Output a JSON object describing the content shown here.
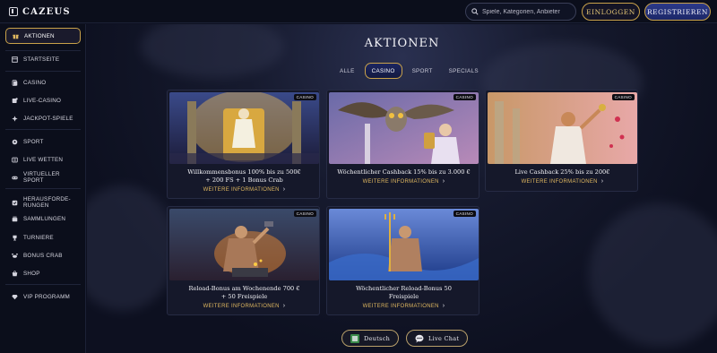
{
  "header": {
    "logo_text": "CAZEUS",
    "search_placeholder": "Spiele, Kategorien, Anbieter",
    "login_label": "EINLOGGEN",
    "register_label": "REGISTRIEREN"
  },
  "sidebar": {
    "items": [
      {
        "label": "AKTIONEN",
        "icon": "gift-icon",
        "active": true
      },
      {
        "label": "STARTSEITE",
        "icon": "home-icon"
      },
      {
        "label": "CASINO",
        "icon": "cards-icon"
      },
      {
        "label": "LIVE-CASINO",
        "icon": "live-casino-icon"
      },
      {
        "label": "JACKPOT-SPIELE",
        "icon": "jackpot-icon"
      },
      {
        "label": "SPORT",
        "icon": "ball-icon"
      },
      {
        "label": "LIVE WETTEN",
        "icon": "live-bet-icon"
      },
      {
        "label": "VIRTUELLER SPORT",
        "icon": "virtual-sport-icon"
      },
      {
        "label": "HERAUSFORDE-",
        "label2": "RUNGEN",
        "icon": "challenge-icon"
      },
      {
        "label": "SAMMLUNGEN",
        "icon": "collections-icon"
      },
      {
        "label": "TURNIERE",
        "icon": "trophy-icon"
      },
      {
        "label": "BONUS CRAB",
        "icon": "crab-icon"
      },
      {
        "label": "SHOP",
        "icon": "shop-icon"
      },
      {
        "label": "VIP PROGRAMM",
        "icon": "diamond-icon"
      }
    ]
  },
  "main": {
    "title": "AKTIONEN",
    "tabs": [
      {
        "label": "ALLE",
        "active": false
      },
      {
        "label": "CASINO",
        "active": true
      },
      {
        "label": "SPORT",
        "active": false
      },
      {
        "label": "SPECIALS",
        "active": false
      }
    ],
    "cards": [
      {
        "badge": "CASINO",
        "title1": "Willkommensbonus 100% bis zu 500€",
        "title2": "+ 200 FS + 1 Bonus Crab",
        "more": "WEITERE INFORMATIONEN"
      },
      {
        "badge": "CASINO",
        "title1": "Wöchentlicher Cashback 15% bis zu 3.000 €",
        "title2": "",
        "more": "WEITERE INFORMATIONEN"
      },
      {
        "badge": "CASINO",
        "title1": "Live Cashback 25% bis zu 200€",
        "title2": "",
        "more": "WEITERE INFORMATIONEN"
      },
      {
        "badge": "CASINO",
        "title1": "Reload-Bonus am Wochenende 700 €",
        "title2": "+ 50 Freispiele",
        "more": "WEITERE INFORMATIONEN"
      },
      {
        "badge": "CASINO",
        "title1": "Wöchentlicher Reload-Bonus 50",
        "title2": "Freispiele",
        "more": "WEITERE INFORMATIONEN"
      }
    ]
  },
  "footer": {
    "language_label": "Deutsch",
    "chat_label": "Live Chat"
  },
  "colors": {
    "accent_gold": "#c9a24a",
    "background": "#0d1020",
    "link_gold": "#e0b860"
  }
}
